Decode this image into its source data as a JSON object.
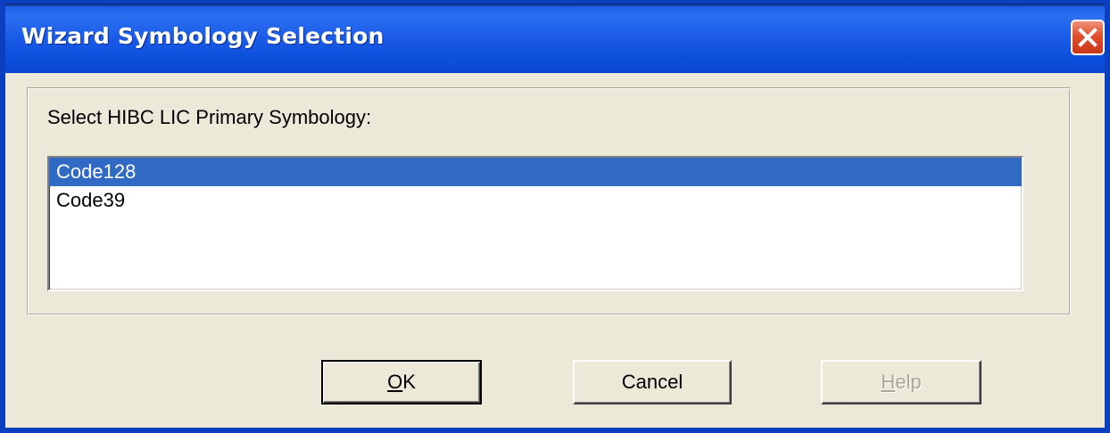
{
  "window": {
    "title": "Wizard Symbology Selection"
  },
  "group": {
    "label": "Select HIBC LIC Primary Symbology:"
  },
  "listbox": {
    "items": [
      {
        "label": "Code128",
        "selected": true
      },
      {
        "label": "Code39",
        "selected": false
      }
    ]
  },
  "buttons": {
    "ok": {
      "mnemonic": "O",
      "rest": "K"
    },
    "cancel": {
      "label": "Cancel"
    },
    "help": {
      "mnemonic": "H",
      "rest": "elp",
      "disabled": true
    }
  },
  "colors": {
    "titlebar": "#0a53d8",
    "client_bg": "#ece9d8",
    "selection": "#316ac5",
    "close_button": "#e0502e"
  },
  "icons": {
    "close": "close-icon"
  }
}
